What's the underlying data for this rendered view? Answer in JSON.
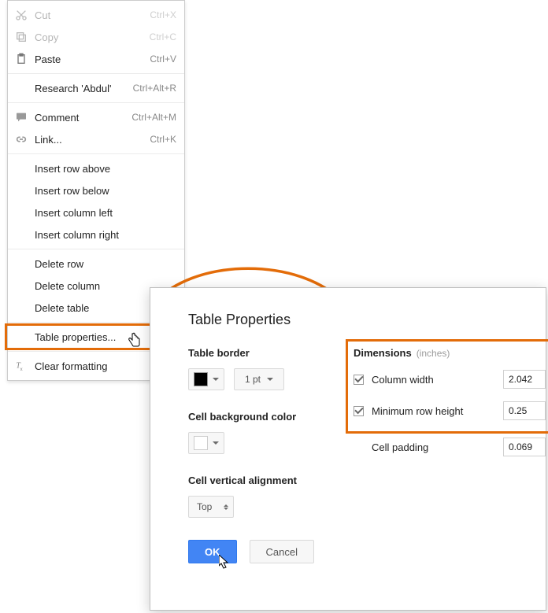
{
  "colors": {
    "accent_orange": "#e36c09",
    "primary_blue": "#4285f4"
  },
  "menu": {
    "items": [
      {
        "label": "Cut",
        "shortcut": "Ctrl+X",
        "disabled": true,
        "icon": "cut"
      },
      {
        "label": "Copy",
        "shortcut": "Ctrl+C",
        "disabled": true,
        "icon": "copy"
      },
      {
        "label": "Paste",
        "shortcut": "Ctrl+V",
        "disabled": false,
        "icon": "paste"
      },
      {
        "sep": true
      },
      {
        "label": "Research 'Abdul'",
        "shortcut": "Ctrl+Alt+R",
        "disabled": false
      },
      {
        "sep": true
      },
      {
        "label": "Comment",
        "shortcut": "Ctrl+Alt+M",
        "disabled": false,
        "icon": "comment"
      },
      {
        "label": "Link...",
        "shortcut": "Ctrl+K",
        "disabled": false,
        "icon": "link"
      },
      {
        "sep": true
      },
      {
        "label": "Insert row above",
        "disabled": false
      },
      {
        "label": "Insert row below",
        "disabled": false
      },
      {
        "label": "Insert column left",
        "disabled": false
      },
      {
        "label": "Insert column right",
        "disabled": false
      },
      {
        "sep": true
      },
      {
        "label": "Delete row",
        "disabled": false
      },
      {
        "label": "Delete column",
        "disabled": false
      },
      {
        "label": "Delete table",
        "disabled": false
      },
      {
        "sep": true
      },
      {
        "label": "Table properties...",
        "disabled": false,
        "highlighted": true
      },
      {
        "sep": true
      },
      {
        "label": "Clear formatting",
        "disabled": false,
        "icon": "clear-format"
      }
    ]
  },
  "dialog": {
    "title": "Table Properties",
    "table_border_label": "Table border",
    "border_width": "1 pt",
    "cell_bg_label": "Cell background color",
    "vertical_align_label": "Cell vertical alignment",
    "vertical_align_value": "Top",
    "dimensions_label": "Dimensions",
    "dimensions_unit": "(inches)",
    "column_width_label": "Column width",
    "column_width_value": "2.042",
    "column_width_checked": true,
    "row_height_label": "Minimum row height",
    "row_height_value": "0.25",
    "row_height_checked": true,
    "cell_padding_label": "Cell padding",
    "cell_padding_value": "0.069",
    "ok_label": "OK",
    "cancel_label": "Cancel"
  }
}
